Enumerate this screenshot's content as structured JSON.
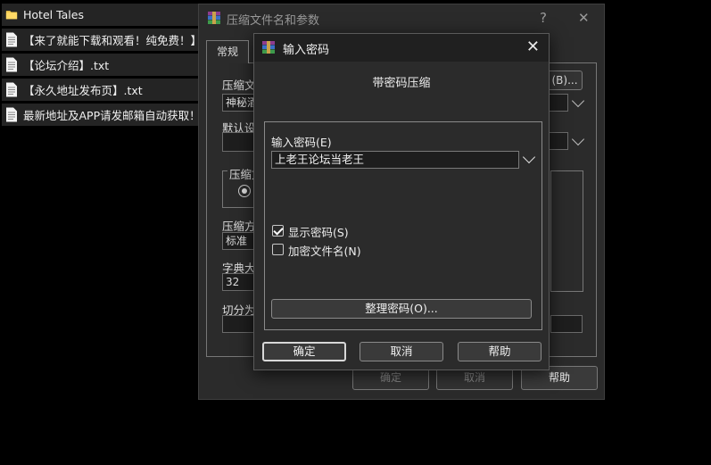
{
  "explorer": {
    "items": [
      {
        "name": "Hotel Tales",
        "icon": "folder-icon"
      },
      {
        "name": "【来了就能下载和观看！纯免费！】.txt",
        "icon": "text-file-icon"
      },
      {
        "name": "【论坛介绍】.txt",
        "icon": "text-file-icon"
      },
      {
        "name": "【永久地址发布页】.txt",
        "icon": "text-file-icon"
      },
      {
        "name": "最新地址及APP请发邮箱自动获取！！",
        "icon": "text-file-icon"
      }
    ]
  },
  "archive_dialog": {
    "title": "压缩文件名和参数",
    "help_glyph": "?",
    "close_glyph": "✕",
    "tab_general": "常规",
    "label_archive_name": "压缩文",
    "archive_name_value": "神秘酒",
    "browse_button": "(B)...",
    "label_default_settings": "默认设",
    "label_archive_format": "压缩文",
    "label_method": "压缩方",
    "method_value": "标准",
    "label_dictionary": "字典大",
    "dictionary_value": "32",
    "label_split": "切分为",
    "ok_button": "确定",
    "cancel_button": "取消",
    "help_button": "帮助"
  },
  "password_dialog": {
    "title": "输入密码",
    "close_glyph": "✕",
    "subtitle": "带密码压缩",
    "password_label": "输入密码(E)",
    "password_value": "上老王论坛当老王",
    "show_password_label": "显示密码(S)",
    "show_password_checked": true,
    "encrypt_filenames_label": "加密文件名(N)",
    "encrypt_filenames_checked": false,
    "organize_button": "整理密码(O)...",
    "ok_button": "确定",
    "cancel_button": "取消",
    "help_button": "帮助"
  },
  "colors": {
    "dialog_bg": "#2b2b2b",
    "titlebar_bg": "#202020",
    "field_bg": "#1e1e1e",
    "folder_yellow": "#f2c94c"
  }
}
